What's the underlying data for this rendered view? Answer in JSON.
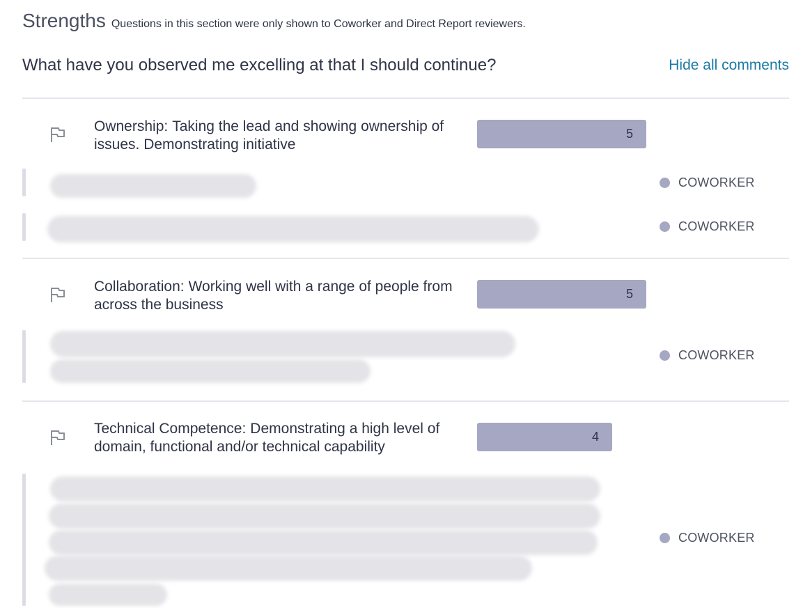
{
  "section": {
    "title": "Strengths",
    "note": "Questions in this section were only shown to Coworker and Direct Report reviewers."
  },
  "question": {
    "text": "What have you observed me excelling at that I should continue?",
    "hide_comments_label": "Hide all comments"
  },
  "rating_scale_max": 5,
  "competencies": [
    {
      "name": "Ownership:",
      "description": "Taking the lead and showing ownership of issues. Demonstrating initiative",
      "score": "5",
      "score_value": 5,
      "comments": [
        {
          "reviewer": "COWORKER"
        },
        {
          "reviewer": "COWORKER"
        }
      ]
    },
    {
      "name": "Collaboration:",
      "description": "Working well with a range of people from across the business",
      "score": "5",
      "score_value": 5,
      "comments": [
        {
          "reviewer": "COWORKER"
        }
      ]
    },
    {
      "name": "Technical Competence:",
      "description": "Demonstrating a high level of domain, functional and/or technical capability",
      "score": "4",
      "score_value": 4,
      "comments": [
        {
          "reviewer": "COWORKER"
        }
      ]
    }
  ],
  "icons": {
    "flag": "flag-icon"
  },
  "colors": {
    "accent_link": "#1a7ba6",
    "bar": "#a6a7c3",
    "text": "#2f3446",
    "divider": "#e4e6ec"
  }
}
